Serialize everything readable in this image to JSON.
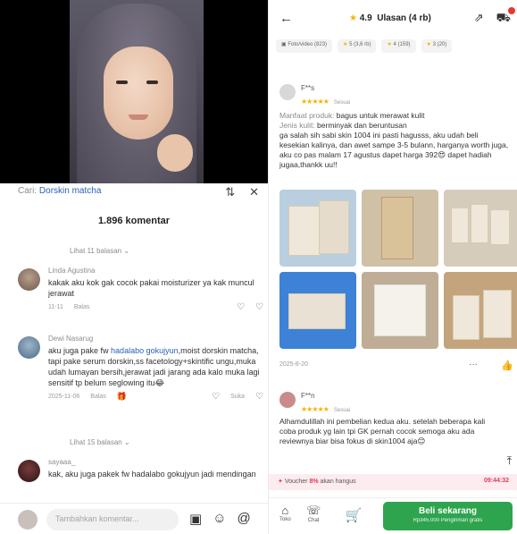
{
  "left": {
    "search_hint_prefix": "Cari:",
    "search_hint_keyword": "Dorskin matcha",
    "comment_count": "1.896 komentar",
    "replies_toggle_top": "Lihat 11 balasan",
    "comments": [
      {
        "user": "Linda Agustina",
        "text": "kakak aku kok gak cocok pakai moisturizer ya kak muncul jerawat",
        "time": "11-11",
        "reply": "Balas"
      },
      {
        "user": "Dewi Nasarug",
        "text_before": "aku juga pake fw ",
        "link": "hadalabo gokujyun",
        "text_after": ",moist dorskin matcha, tapi pake serum dorskin,ss facetology+skintific ungu,muka udah lumayan bersih,jerawat jadi jarang ada kalo muka lagi sensitif tp belum seglowing itu😂",
        "time": "2025-11-06",
        "reply": "Balas",
        "likes": "Suka"
      },
      {
        "user": "sayaaa_",
        "text": "kak, aku juga pakek fw hadalabo gokujyun jadi mendingan"
      }
    ],
    "replies_toggle_mid": "Lihat 15 balasan",
    "composer_placeholder": "Tambahkan komentar..."
  },
  "right": {
    "rating": "4.9",
    "rating_label": "Ulasan (4 rb)",
    "filters": [
      "Foto/video (823)",
      "5 (3,6 rb)",
      "4 (159)",
      "3 (20)"
    ],
    "review1": {
      "user": "F**s",
      "stars": "★★★★★",
      "tag": "Sesuai",
      "line1_muted": "Manfaat produk:",
      "line1_rest": " bagus untuk merawat kulit",
      "line2_muted": "Jenis kulit:",
      "line2_rest": " berminyak dan beruntusan",
      "body": "ga salah sih sabi skin 1004 ini pasti hagusss, aku udah beli kesekian kalinya, dan awet sampe 3-5 bulann, harganya worth juga, aku co pas malam 17 agustus dapet harga 392😍 dapet hadiah jugaa,thankk uu!!",
      "date": "2025-8-20"
    },
    "review2": {
      "user": "F**n",
      "stars": "★★★★★",
      "tag": "Sesuai",
      "body": "Alhamdulillah ini pembelian kedua aku. setelah beberapa kali coba produk yg lain tpi GK pernah cocok semoga aku ada reviewnya biar bisa fokus di skin1004 aja😊"
    },
    "voucher_prefix": "Voucher",
    "voucher_pct": "8%",
    "voucher_suffix": " akan hangus",
    "voucher_timer": "09:44:32",
    "bottom": {
      "store_label": "Toko",
      "chat_label": "Chat",
      "buy_label": "Beli sekarang",
      "buy_sub": "Rp345.000 Pengiriman gratis"
    }
  }
}
